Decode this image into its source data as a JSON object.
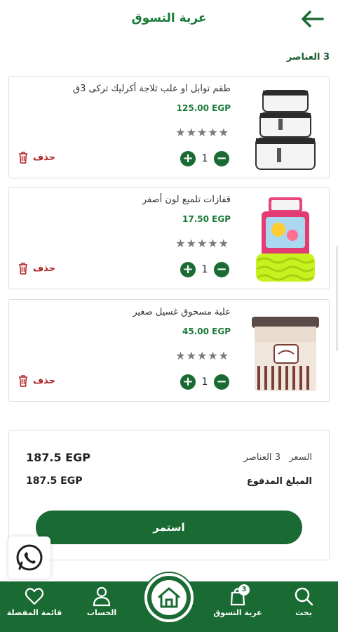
{
  "header": {
    "title": "عربة التسوق"
  },
  "items_count_label": "3 العناصر",
  "items": [
    {
      "name": "طقم توابل او علب ثلاجة أكرليك تركى 3ق",
      "price": "125.00 EGP",
      "stars": "★★★★★",
      "qty": "1",
      "delete": "حذف"
    },
    {
      "name": "قفازات تلميع لون أصفر",
      "price": "17.50 EGP",
      "stars": "★★★★★",
      "qty": "1",
      "delete": "حذف"
    },
    {
      "name": "علبة مسحوق غسيل صغير",
      "price": "45.00 EGP",
      "stars": "★★★★★",
      "qty": "1",
      "delete": "حذف"
    }
  ],
  "summary": {
    "price_label": "السعر",
    "items_label": "3 العناصر",
    "price_value": "187.5 EGP",
    "paid_label": "المبلغ المدفوع",
    "paid_value": "187.5 EGP",
    "continue": "استمر"
  },
  "nav": {
    "search": "بحث",
    "cart": "عربة التسوق",
    "cart_badge": "3",
    "account": "الحساب",
    "favorites": "قائمة المفضلة"
  },
  "colors": {
    "brand": "#1a6b33",
    "accent": "#1a7a3a",
    "delete": "#b22222"
  }
}
